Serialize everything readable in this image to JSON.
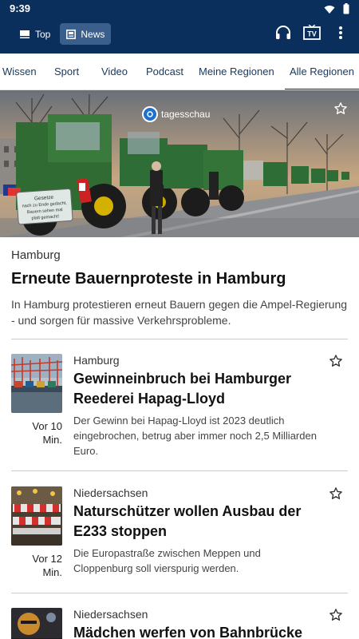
{
  "status": {
    "time": "9:39"
  },
  "header": {
    "segments": [
      {
        "label": "Top",
        "active": false
      },
      {
        "label": "News",
        "active": true
      }
    ],
    "icons": [
      "headphones-icon",
      "tv-icon",
      "more-vert-icon"
    ],
    "tv_label": "TV"
  },
  "tabs": [
    {
      "label": "Wissen"
    },
    {
      "label": "Sport"
    },
    {
      "label": "Video"
    },
    {
      "label": "Podcast"
    },
    {
      "label": "Meine Regionen"
    },
    {
      "label": "Alle Regionen",
      "active": true
    }
  ],
  "hero": {
    "brand": "tagesschau",
    "sign_text": "Gesetze nach zu Ende gedacht, Bauern sehen mal platt gemacht!"
  },
  "lead": {
    "topline": "Hamburg",
    "headline": "Erneute Bauernproteste in Hamburg",
    "teaser": "In Hamburg protestieren erneut Bauern gegen die Ampel-Regierung - und sorgen für massive Verkehrsprobleme."
  },
  "articles": [
    {
      "topline": "Hamburg",
      "headline": "Gewinneinbruch bei Hamburger Reederei Hapag-Lloyd",
      "teaser": "Der Gewinn bei Hapag-Lloyd ist 2023 deutlich eingebrochen, betrug aber immer noch 2,5 Milliarden Euro.",
      "time": "Vor 10 Min."
    },
    {
      "topline": "Niedersachsen",
      "headline": "Naturschützer wollen Ausbau der E233 stoppen",
      "teaser": "Die Europastraße zwischen Meppen und Cloppenburg soll vierspurig werden.",
      "time": "Vor 12 Min."
    },
    {
      "topline": "Niedersachsen",
      "headline": "Mädchen werfen von Bahnbrücke",
      "teaser": "",
      "time": ""
    }
  ],
  "colors": {
    "header_bg": "#0b2f5c",
    "accent": "#1e6fd0"
  }
}
